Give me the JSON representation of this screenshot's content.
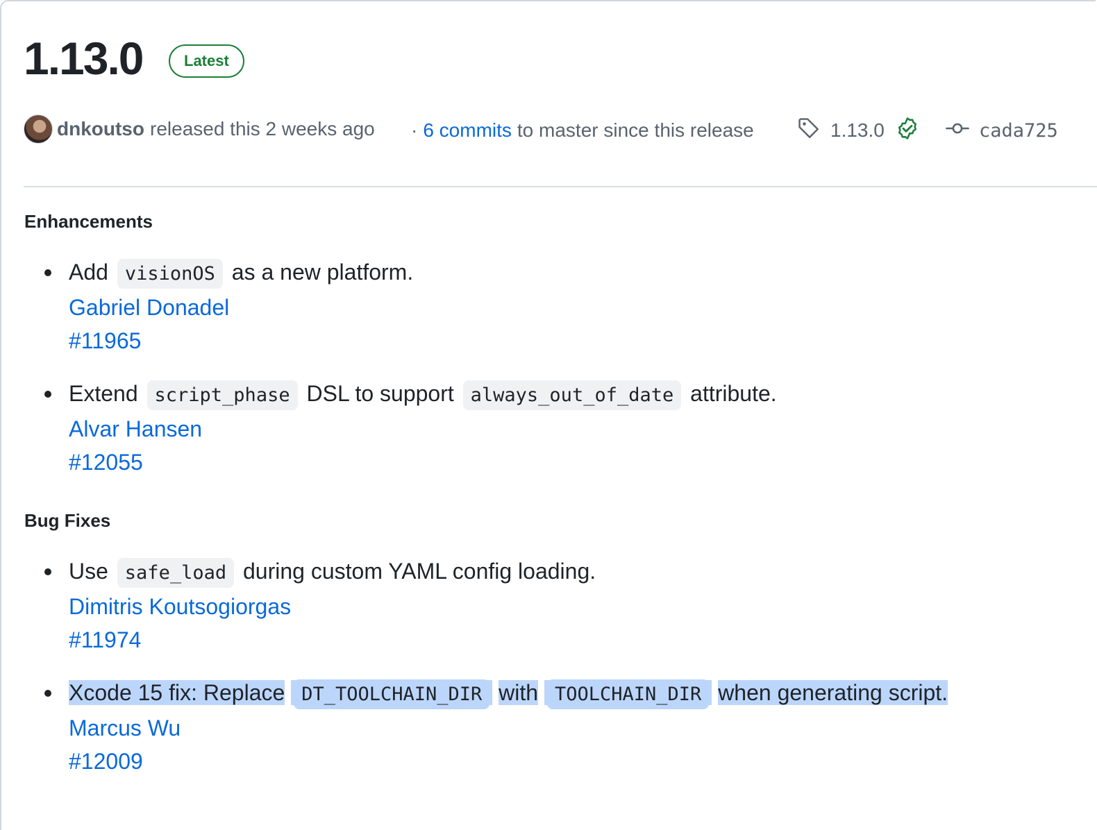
{
  "release": {
    "version": "1.13.0",
    "badge": "Latest",
    "author": "dnkoutso",
    "released_text": "released this 2 weeks ago",
    "separator": "·",
    "commits_link": "6 commits",
    "commits_suffix": "to master since this release",
    "tag": "1.13.0",
    "commit": "cada725"
  },
  "sections": {
    "enhancements": {
      "title": "Enhancements",
      "items": [
        {
          "pre": "Add",
          "code1": "visionOS",
          "post": "as a new platform.",
          "author": "Gabriel Donadel",
          "pr": "#11965"
        },
        {
          "pre": "Extend",
          "code1": "script_phase",
          "mid": "DSL to support",
          "code2": "always_out_of_date",
          "post": "attribute.",
          "author": "Alvar Hansen",
          "pr": "#12055"
        }
      ]
    },
    "bugfixes": {
      "title": "Bug Fixes",
      "items": [
        {
          "pre": "Use",
          "code1": "safe_load",
          "post": "during custom YAML config loading.",
          "author": "Dimitris Koutsogiorgas",
          "pr": "#11974"
        },
        {
          "pre": "Xcode 15 fix: Replace",
          "code1": "DT_TOOLCHAIN_DIR",
          "mid": "with",
          "code2": "TOOLCHAIN_DIR",
          "post": "when generating script.",
          "author": "Marcus Wu",
          "pr": "#12009"
        }
      ]
    }
  },
  "colors": {
    "link": "#0969da",
    "badge_green": "#1a7f37",
    "selection": "#bcd6fb"
  }
}
